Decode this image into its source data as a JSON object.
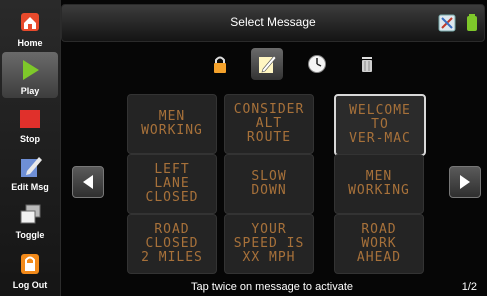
{
  "header": {
    "title": "Select Message"
  },
  "sidebar": {
    "items": [
      {
        "label": "Home",
        "icon": "home-icon"
      },
      {
        "label": "Play",
        "icon": "play-icon",
        "active": true
      },
      {
        "label": "Stop",
        "icon": "stop-icon"
      },
      {
        "label": "Edit Msg",
        "icon": "edit-message-icon"
      },
      {
        "label": "Toggle",
        "icon": "toggle-icon"
      },
      {
        "label": "Log Out",
        "icon": "logout-lock-icon"
      }
    ]
  },
  "toolbar": {
    "items": [
      {
        "icon": "lock-icon"
      },
      {
        "icon": "edit-note-icon",
        "active": true
      },
      {
        "icon": "clock-icon"
      },
      {
        "icon": "trash-icon"
      }
    ]
  },
  "messages": [
    {
      "text": "MEN\nWORKING"
    },
    {
      "text": "CONSIDER\nALT\nROUTE"
    },
    {
      "text": "WELCOME\nTO\nVER-MAC",
      "selected": true
    },
    {
      "text": "LEFT\nLANE\nCLOSED"
    },
    {
      "text": "SLOW\nDOWN"
    },
    {
      "text": "MEN\nWORKING"
    },
    {
      "text": "ROAD\nCLOSED\n2 MILES"
    },
    {
      "text": "YOUR\nSPEED IS\nXX MPH"
    },
    {
      "text": "ROAD\nWORK\nAHEAD"
    }
  ],
  "footer": {
    "hint": "Tap twice on message to activate",
    "page": "1/2"
  },
  "colors": {
    "led_text": "#a7713a",
    "accent_green": "#7ec82a",
    "stop_red": "#e0302b"
  }
}
